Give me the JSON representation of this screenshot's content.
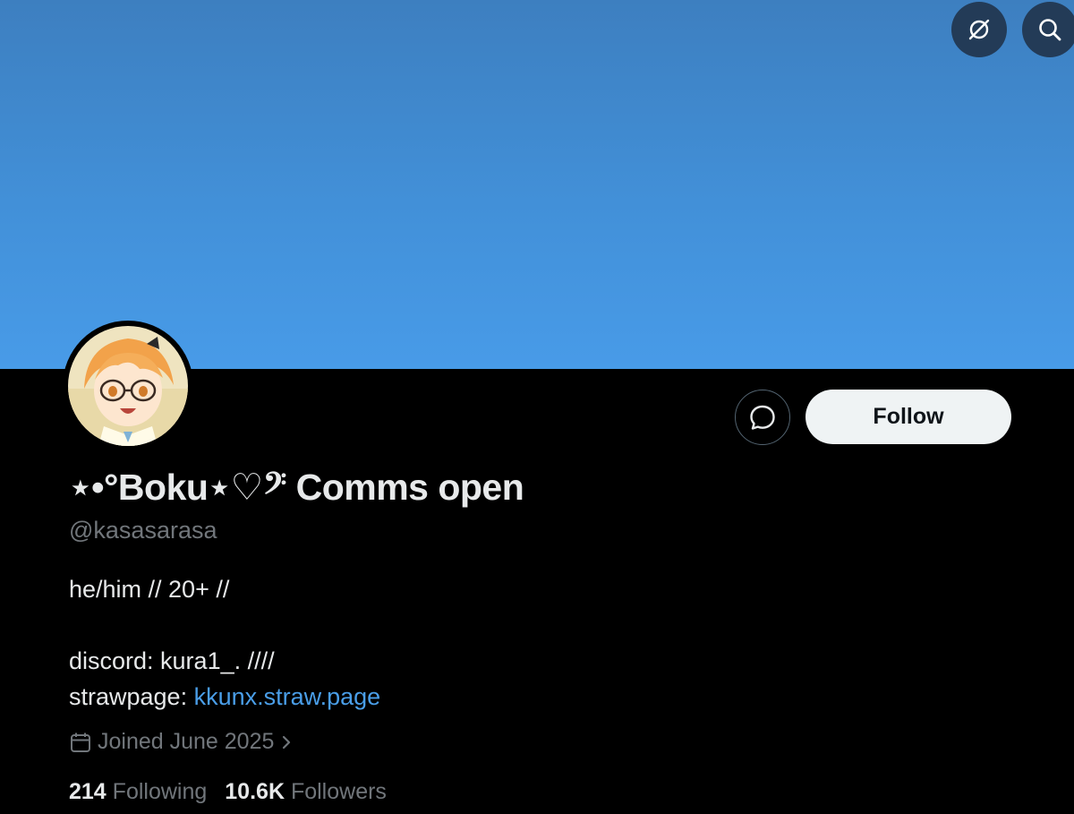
{
  "header": {
    "icons": [
      "hide-repost-icon",
      "search-icon"
    ]
  },
  "profile": {
    "display_name": "⋆•°Boku⋆♡𝄢 Comms open",
    "handle": "@kasasarasa",
    "bio": {
      "line1": "he/him // 20+ //",
      "line2": "discord: kura1_. ////",
      "line3_label": "strawpage: ",
      "line3_link": "kkunx.straw.page"
    },
    "joined": "Joined June 2025",
    "following_count": "214",
    "following_label": "Following",
    "followers_count": "10.6K",
    "followers_label": "Followers"
  },
  "actions": {
    "follow_label": "Follow"
  },
  "colors": {
    "banner": "#4290d8",
    "link": "#4a9ee8",
    "muted": "#71767b"
  }
}
